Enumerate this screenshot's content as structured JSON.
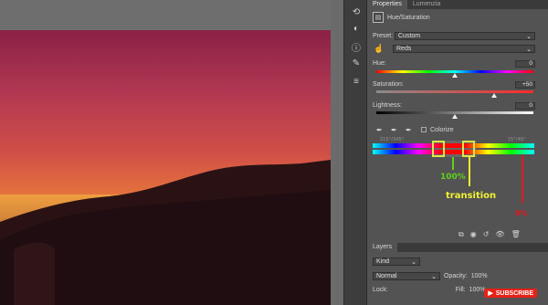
{
  "canvas": {
    "label": "canvas area"
  },
  "panel": {
    "tabs": [
      "Properties",
      "Lumenzia"
    ],
    "section_title": "Hue/Saturation",
    "preset_label": "Preset:",
    "preset_value": "Custom",
    "channel_value": "Reds",
    "hue_label": "Hue:",
    "hue_value": "0",
    "saturation_label": "Saturation:",
    "saturation_value": "+50",
    "lightness_label": "Lightness:",
    "lightness_value": "0",
    "colorize_label": "Colorize",
    "range_left_readout": "315°/345°",
    "range_right_readout": "15°/45°",
    "hue_position": 0.5,
    "saturation_position": 0.75,
    "lightness_position": 0.5
  },
  "annotations": {
    "full_label": "100%",
    "transition_label": "transition",
    "zero_label": "0%",
    "colors": {
      "box": "#d8e84a",
      "full": "#5fd21a",
      "transition": "#f1f232",
      "zero": "#e4181e"
    }
  },
  "layers": {
    "tab_label": "Layers",
    "kind_label": "Kind",
    "blend_mode": "Normal",
    "opacity_label": "Opacity:",
    "opacity_value": "100%",
    "lock_label": "Lock:",
    "fill_label": "Fill:",
    "fill_value": "100%"
  },
  "watermark": {
    "subscribe_label": "SUBSCRIBE"
  },
  "icons": [
    "history-icon",
    "adjust-icon",
    "info-icon",
    "brush-icon",
    "layers-icon",
    "eyedropper-icon",
    "eyedropper-plus-icon",
    "eyedropper-minus-icon",
    "hand-target-icon",
    "clip-icon",
    "visibility-icon",
    "reset-icon",
    "eye-icon",
    "trash-icon"
  ]
}
